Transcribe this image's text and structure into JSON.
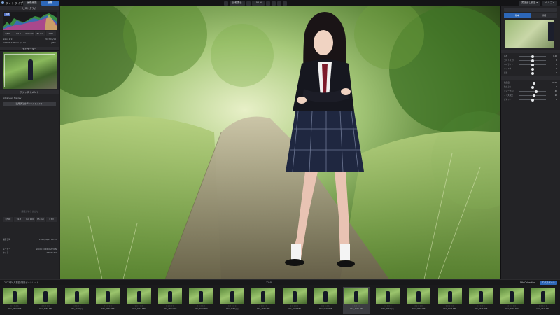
{
  "app": {
    "title": "フォトライブラリ",
    "tabs": [
      {
        "label": "画像編集",
        "active": false
      },
      {
        "label": "編集",
        "active": true
      }
    ],
    "toolbar": {
      "compare_label": "比較表示",
      "zoom_label": "100 %"
    },
    "right_menu": [
      "書き出し設定 ▾",
      "ヘルプ ▾"
    ]
  },
  "left_panel": {
    "histogram_title": "ヒストグラム",
    "histogram_chip": "RGB",
    "exif": [
      "1/500",
      "f/2.8",
      "ISO 100",
      "85 mm",
      "0 EV"
    ],
    "exif_lines": [
      {
        "label": "Nikon Z 9",
        "value": "2023/06/14"
      },
      {
        "label": "NIKKOR Z 85mm f/1.2 S",
        "value": "JPEG"
      }
    ],
    "navigator_title": "ナビゲーター",
    "adjust_title": "アジャストメント",
    "advanced_label": "Advanced History",
    "apply_button": "適用済みのアジャストメント",
    "empty_label": "履歴がありません",
    "exif2": [
      "1/500",
      "f/2.8",
      "ISO 100",
      "85 mm",
      "0 EV"
    ],
    "meta_rows": [
      {
        "label": "撮影日時",
        "value": "2023/06/14 10:32"
      },
      {
        "label": "メーカー",
        "value": "NIKON CORPORATION"
      },
      {
        "label": "カメラ",
        "value": "NIKON Z 9"
      }
    ]
  },
  "right_panel": {
    "tabs": [
      {
        "label": "基本",
        "active": true
      },
      {
        "label": "詳細",
        "active": false
      }
    ],
    "sliders": [
      {
        "label": "露出",
        "value": "0.00",
        "pos": 0.5
      },
      {
        "label": "コントラスト",
        "value": "0",
        "pos": 0.5
      },
      {
        "label": "ハイライト",
        "value": "0",
        "pos": 0.5
      },
      {
        "label": "シャドウ",
        "value": "0",
        "pos": 0.5
      },
      {
        "label": "彩度",
        "value": "0",
        "pos": 0.5
      },
      {
        "label": "色温度",
        "value": "5500",
        "pos": 0.55
      },
      {
        "label": "色かぶり",
        "value": "0",
        "pos": 0.5
      },
      {
        "label": "シャープネス",
        "value": "40",
        "pos": 0.62
      },
      {
        "label": "ノイズ除去",
        "value": "20",
        "pos": 0.56
      },
      {
        "label": "ビネット",
        "value": "0",
        "pos": 0.5
      }
    ]
  },
  "filmbar": {
    "path": "2023年6月撮影/制服ポートレート",
    "count": "12/48",
    "chips": [
      {
        "label": "Nik Collection",
        "blue": false
      },
      {
        "label": "エクスポート",
        "blue": true
      }
    ]
  },
  "filmstrip": [
    {
      "name": "DSC_4653.NEF",
      "selected": false
    },
    {
      "name": "DSC_4655.NEF",
      "selected": false
    },
    {
      "name": "DSC_4658.jpg",
      "selected": false
    },
    {
      "name": "DSC_4661.NEF",
      "selected": false
    },
    {
      "name": "DSC_4663.NEF",
      "selected": false
    },
    {
      "name": "DSC_4664.NEF",
      "selected": false
    },
    {
      "name": "DSC_4665.NEF",
      "selected": false
    },
    {
      "name": "DSC_4667.jpg",
      "selected": false
    },
    {
      "name": "DSC_4668.NEF",
      "selected": false
    },
    {
      "name": "DSC_4669.NEF",
      "selected": false
    },
    {
      "name": "DSC_4670.NEF",
      "selected": false
    },
    {
      "name": "DSC_4671.NEF",
      "selected": true
    },
    {
      "name": "DSC_4672.jpg",
      "selected": false
    },
    {
      "name": "DSC_4673.NEF",
      "selected": false
    },
    {
      "name": "DSC_4674.NEF",
      "selected": false
    },
    {
      "name": "DSC_4675.NEF",
      "selected": false
    },
    {
      "name": "DSC_4676.NEF",
      "selected": false
    },
    {
      "name": "DSC_4677.NEF",
      "selected": false
    }
  ]
}
